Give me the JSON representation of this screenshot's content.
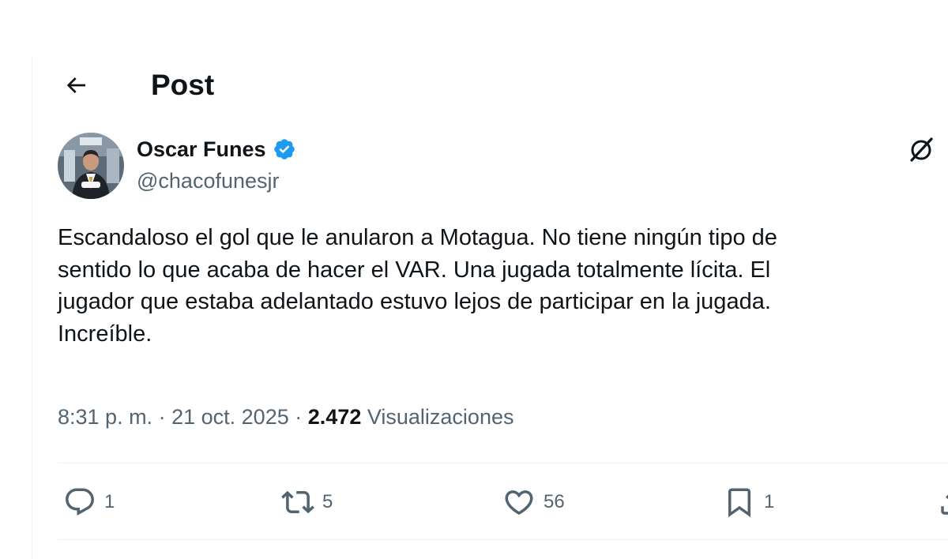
{
  "header": {
    "title": "Post"
  },
  "author": {
    "name": "Oscar Funes",
    "handle": "@chacofunesjr",
    "verified": true,
    "verified_color": "#1d9bf0"
  },
  "tweet": {
    "text": "Escandaloso el gol que le anularon a Motagua. No tiene ningún tipo de\nsentido lo que acaba de hacer el VAR. Una jugada totalmente lícita. El\njugador que estaba adelantado estuvo lejos de participar en la jugada.\nIncreíble.",
    "time": "8:31 p. m.",
    "separator": "·",
    "date": "21 oct. 2025",
    "views_count": "2.472",
    "views_label": "Visualizaciones"
  },
  "actions": {
    "reply_count": "1",
    "retweet_count": "5",
    "like_count": "56",
    "bookmark_count": "1"
  },
  "icons": {
    "back": "arrow-left-icon",
    "grok": "grok-icon",
    "reply": "reply-icon",
    "retweet": "retweet-icon",
    "like": "heart-icon",
    "bookmark": "bookmark-icon",
    "share": "share-icon"
  },
  "colors": {
    "text_primary": "#0f1419",
    "text_secondary": "#536471",
    "divider": "#eff3f4"
  }
}
